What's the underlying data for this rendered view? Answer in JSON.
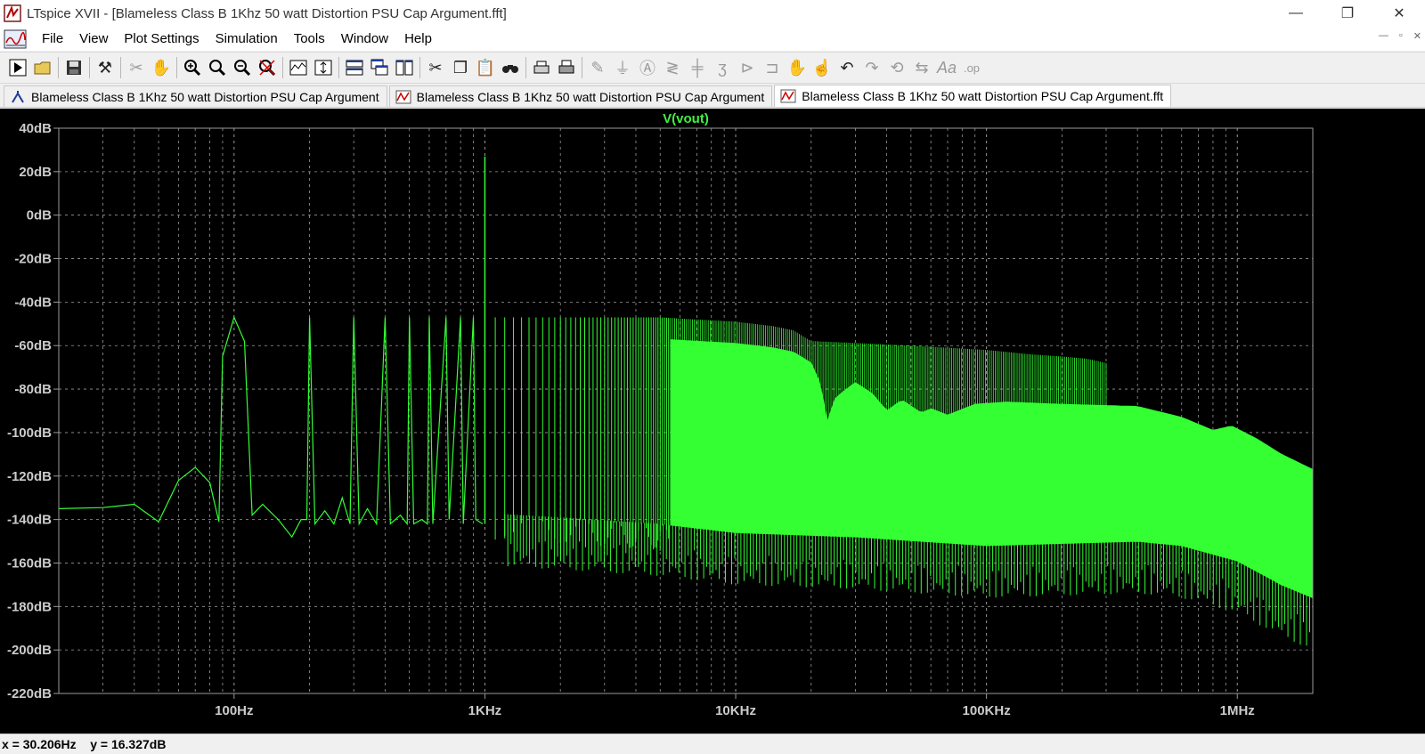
{
  "window": {
    "title": "LTspice XVII - [Blameless Class B 1Khz 50 watt Distortion PSU Cap Argument.fft]",
    "minimize_glyph": "—",
    "maximize_glyph": "❐",
    "close_glyph": "✕"
  },
  "menu": {
    "items": [
      "File",
      "View",
      "Plot Settings",
      "Simulation",
      "Tools",
      "Window",
      "Help"
    ],
    "mdi_min": "—",
    "mdi_restore": "▫",
    "mdi_close": "✕"
  },
  "toolbar": {
    "icons": [
      "run-icon",
      "open-icon",
      "save-icon",
      "control-panel-icon",
      "halt-icon",
      "pan-icon",
      "zoom-in-icon",
      "zoom-full-icon",
      "zoom-out-icon",
      "zoom-cancel-icon",
      "autorange-icon",
      "autorange-y-icon",
      "tile-horizontal-icon",
      "cascade-icon",
      "tile-vertical-icon",
      "cut-icon",
      "copy-icon",
      "paste-icon",
      "find-icon",
      "print-preview-icon",
      "print-icon",
      "wire-icon",
      "ground-icon",
      "label-net-icon",
      "resistor-icon",
      "capacitor-icon",
      "inductor-icon",
      "diode-icon",
      "component-icon",
      "move-icon",
      "drag-icon",
      "undo-icon",
      "redo-icon",
      "rotate-icon",
      "mirror-icon",
      "text-icon",
      "spice-directive-icon"
    ]
  },
  "tabs": [
    {
      "label": "Blameless Class B 1Khz 50 watt Distortion PSU Cap Argument",
      "kind": "schematic"
    },
    {
      "label": "Blameless Class B 1Khz 50 watt Distortion PSU Cap Argument",
      "kind": "waveform"
    },
    {
      "label": "Blameless Class B 1Khz 50 watt Distortion PSU Cap Argument.fft",
      "kind": "waveform",
      "active": true
    }
  ],
  "status": {
    "text": "x = 30.206Hz    y = 16.327dB"
  },
  "colors": {
    "trace": "#33ff33",
    "trace_title": "#44ee44",
    "plot_bg": "#000000",
    "axis_text": "#cccccc",
    "grid": "#9a9a9a"
  },
  "chart_data": {
    "type": "line",
    "title": "V(vout)",
    "xlabel": "",
    "ylabel": "",
    "x_scale": "log",
    "xlim": [
      20,
      2000000
    ],
    "ylim": [
      -220,
      40
    ],
    "grid": true,
    "x_ticks": [
      {
        "value": 100,
        "label": "100Hz"
      },
      {
        "value": 1000,
        "label": "1KHz"
      },
      {
        "value": 10000,
        "label": "10KHz"
      },
      {
        "value": 100000,
        "label": "100KHz"
      },
      {
        "value": 1000000,
        "label": "1MHz"
      }
    ],
    "y_ticks": [
      {
        "value": 40,
        "label": "40dB"
      },
      {
        "value": 20,
        "label": "20dB"
      },
      {
        "value": 0,
        "label": "0dB"
      },
      {
        "value": -20,
        "label": "-20dB"
      },
      {
        "value": -40,
        "label": "-40dB"
      },
      {
        "value": -60,
        "label": "-60dB"
      },
      {
        "value": -80,
        "label": "-80dB"
      },
      {
        "value": -100,
        "label": "-100dB"
      },
      {
        "value": -120,
        "label": "-120dB"
      },
      {
        "value": -140,
        "label": "-140dB"
      },
      {
        "value": -160,
        "label": "-160dB"
      },
      {
        "value": -180,
        "label": "-180dB"
      },
      {
        "value": -200,
        "label": "-200dB"
      },
      {
        "value": -220,
        "label": "-220dB"
      }
    ],
    "series": [
      {
        "name": "V(vout)",
        "fundamental": {
          "x": 1000,
          "y": 27
        },
        "low_frequency_curve": [
          [
            20,
            -135
          ],
          [
            30,
            -134.5
          ],
          [
            40,
            -133
          ],
          [
            50,
            -141
          ],
          [
            60,
            -122
          ],
          [
            70,
            -116
          ],
          [
            80,
            -123
          ],
          [
            87,
            -141
          ],
          [
            90,
            -65
          ],
          [
            100,
            -47
          ],
          [
            110,
            -58
          ],
          [
            118,
            -138
          ],
          [
            130,
            -133
          ],
          [
            150,
            -140
          ],
          [
            170,
            -148
          ],
          [
            185,
            -140
          ],
          [
            195,
            -140
          ],
          [
            200,
            -47
          ],
          [
            210,
            -142
          ],
          [
            230,
            -136
          ],
          [
            250,
            -142
          ],
          [
            270,
            -130
          ],
          [
            290,
            -142
          ],
          [
            300,
            -47
          ],
          [
            315,
            -142
          ],
          [
            340,
            -135
          ],
          [
            370,
            -142
          ],
          [
            400,
            -47
          ],
          [
            420,
            -142
          ],
          [
            460,
            -138
          ],
          [
            490,
            -142
          ],
          [
            500,
            -47
          ],
          [
            520,
            -142
          ],
          [
            560,
            -140
          ],
          [
            590,
            -142
          ],
          [
            600,
            -47
          ],
          [
            620,
            -142
          ],
          [
            700,
            -47
          ],
          [
            720,
            -140
          ],
          [
            800,
            -47
          ],
          [
            820,
            -142
          ],
          [
            900,
            -47
          ],
          [
            920,
            -140
          ],
          [
            980,
            -142
          ]
        ],
        "envelope_upper": [
          [
            1100,
            -47
          ],
          [
            2000,
            -47
          ],
          [
            5000,
            -47
          ],
          [
            7000,
            -48
          ],
          [
            10000,
            -49
          ],
          [
            14000,
            -51
          ],
          [
            17000,
            -53
          ],
          [
            20000,
            -58
          ],
          [
            22000,
            -69
          ],
          [
            23000,
            -86
          ],
          [
            25000,
            -74
          ],
          [
            30000,
            -67
          ],
          [
            35000,
            -72
          ],
          [
            40000,
            -80
          ],
          [
            46000,
            -75
          ],
          [
            55000,
            -81
          ],
          [
            60000,
            -79
          ],
          [
            70000,
            -82
          ],
          [
            90000,
            -77
          ],
          [
            120000,
            -76
          ],
          [
            200000,
            -77
          ],
          [
            400000,
            -78
          ],
          [
            600000,
            -83
          ],
          [
            800000,
            -89
          ],
          [
            950000,
            -87
          ],
          [
            1200000,
            -93
          ],
          [
            1500000,
            -100
          ],
          [
            2000000,
            -107
          ]
        ],
        "spur_top": [
          [
            21000,
            -58
          ],
          [
            50000,
            -60
          ],
          [
            100000,
            -62
          ],
          [
            150000,
            -64
          ],
          [
            200000,
            -65
          ],
          [
            250000,
            -66
          ],
          [
            300000,
            -68
          ]
        ],
        "noise_floor": [
          [
            1000,
            -143
          ],
          [
            2000,
            -145
          ],
          [
            5000,
            -148
          ],
          [
            10000,
            -152
          ],
          [
            30000,
            -154
          ],
          [
            100000,
            -158
          ],
          [
            200000,
            -157
          ],
          [
            400000,
            -156
          ],
          [
            600000,
            -158
          ],
          [
            1000000,
            -165
          ],
          [
            1500000,
            -176
          ],
          [
            2000000,
            -182
          ]
        ],
        "dense_from": 5500
      }
    ]
  }
}
